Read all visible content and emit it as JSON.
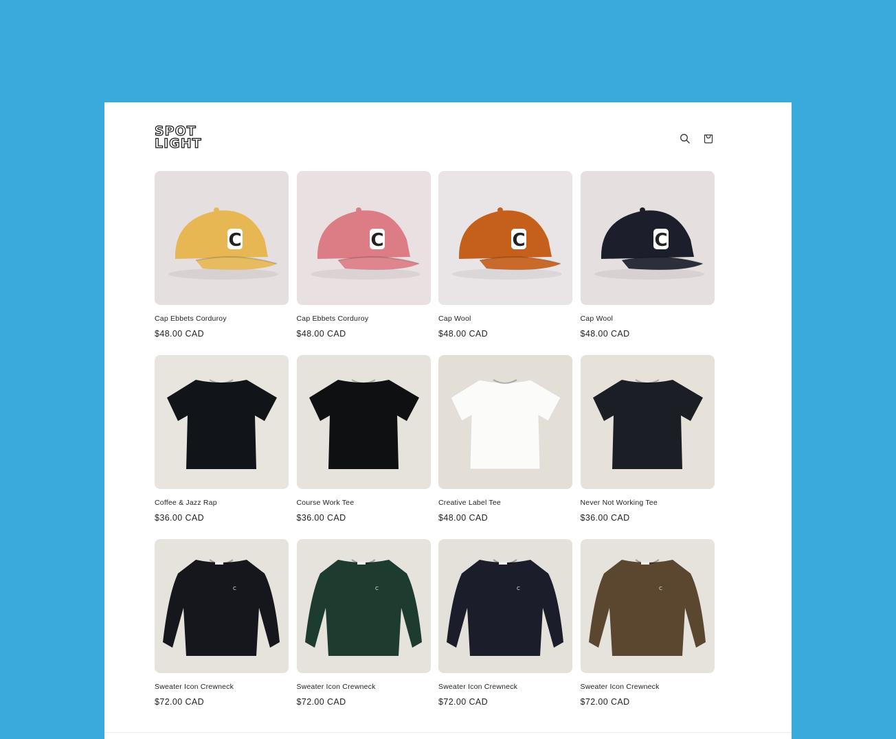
{
  "store": {
    "logo_line1": "SPOT",
    "logo_line2": "LIGHT"
  },
  "header": {
    "icons": [
      "search-icon",
      "cart-icon"
    ]
  },
  "colors": {
    "background": "#3aa9dc",
    "page": "#ffffff",
    "text": "#222222"
  },
  "products": [
    {
      "title": "Cap Ebbets Corduroy",
      "price": "$48.00 CAD",
      "kind": "cap",
      "color": "#e7b754",
      "bg": "#e6dfdf"
    },
    {
      "title": "Cap Ebbets Corduroy",
      "price": "$48.00 CAD",
      "kind": "cap",
      "color": "#dc7d86",
      "bg": "#e8e0e1"
    },
    {
      "title": "Cap Wool",
      "price": "$48.00 CAD",
      "kind": "cap",
      "color": "#c4601c",
      "bg": "#e9e5e6"
    },
    {
      "title": "Cap Wool",
      "price": "$48.00 CAD",
      "kind": "cap",
      "color": "#1c1f2b",
      "bg": "#e6dfe0"
    },
    {
      "title": "Coffee & Jazz Rap",
      "price": "$36.00 CAD",
      "kind": "tee",
      "color": "#111418",
      "bg": "#e8e4de"
    },
    {
      "title": "Course Work Tee",
      "price": "$36.00 CAD",
      "kind": "tee",
      "color": "#0f1012",
      "bg": "#e6e2dc"
    },
    {
      "title": "Creative Label Tee",
      "price": "$48.00 CAD",
      "kind": "tee",
      "color": "#fbfbfa",
      "bg": "#e3ded6"
    },
    {
      "title": "Never Not Working Tee",
      "price": "$36.00 CAD",
      "kind": "tee",
      "color": "#1b1f25",
      "bg": "#e6e1d9"
    },
    {
      "title": "Sweater Icon Crewneck",
      "price": "$72.00 CAD",
      "kind": "sweater",
      "color": "#15171c",
      "bg": "#e6e2dc"
    },
    {
      "title": "Sweater Icon Crewneck",
      "price": "$72.00 CAD",
      "kind": "sweater",
      "color": "#1e3b30",
      "bg": "#e6e2dc"
    },
    {
      "title": "Sweater Icon Crewneck",
      "price": "$72.00 CAD",
      "kind": "sweater",
      "color": "#1b1d2b",
      "bg": "#e4e0da"
    },
    {
      "title": "Sweater Icon Crewneck",
      "price": "$72.00 CAD",
      "kind": "sweater",
      "color": "#5b4630",
      "bg": "#e6e2dc"
    }
  ]
}
